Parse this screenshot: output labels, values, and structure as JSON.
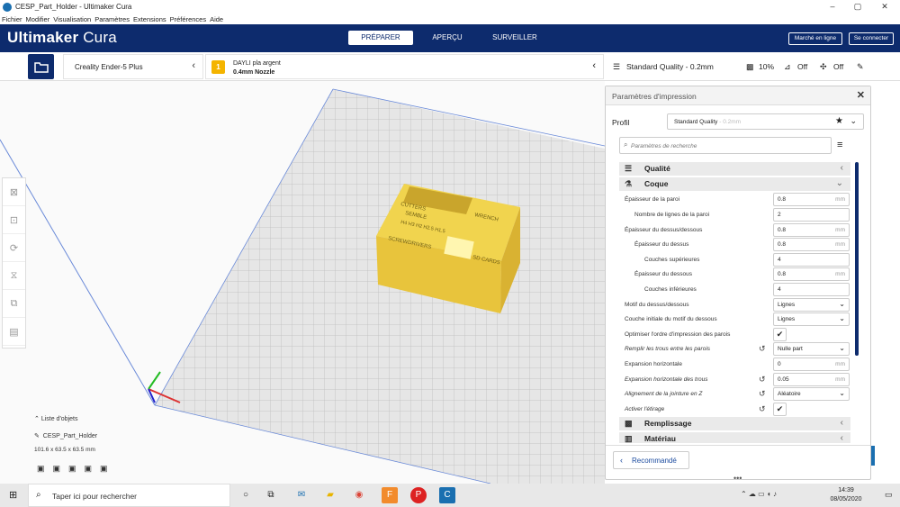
{
  "window": {
    "title": "CESP_Part_Holder - Ultimaker Cura",
    "minimize": "–",
    "maximize": "▢",
    "close": "✕"
  },
  "menu": [
    "Fichier",
    "Modifier",
    "Visualisation",
    "Paramètres",
    "Extensions",
    "Préférences",
    "Aide"
  ],
  "header": {
    "brand_bold": "Ultimaker",
    "brand_light": " Cura",
    "stages": [
      "PRÉPARER",
      "APERÇU",
      "SURVEILLER"
    ],
    "active_stage": "PRÉPARER",
    "marketplace": "Marché en ligne",
    "login": "Se connecter"
  },
  "toolbar": {
    "printer": "Creality Ender-5 Plus",
    "extruder_badge": "1",
    "material": "DAYLI pla argent",
    "nozzle": "0.4mm Nozzle",
    "quality": "Standard Quality - 0.2mm",
    "infill": "10%",
    "support": "Off",
    "adhesion": "Off"
  },
  "model": {
    "label_top1": "CUTTERS",
    "label_top2": "SEMBLE",
    "label_top3": "WRENCH",
    "label_side1": "SCREWDRIVERS",
    "label_side2": "SD CARDS",
    "label_hex": "H4 H3 H2 H2.5 H1.5",
    "color": "#f4dc5a"
  },
  "objects": {
    "header": "Liste d'objets",
    "name": "CESP_Part_Holder",
    "dims": "101.6 x 63.5 x 63.5 mm"
  },
  "panel": {
    "title": "Paramètres d'impression",
    "profile_label": "Profil",
    "profile_value": "Standard Quality",
    "profile_sub": " - 0.2mm",
    "search_placeholder": "Paramètres de recherche",
    "categories": {
      "quality": "Qualité",
      "shell": "Coque",
      "infill": "Remplissage",
      "material": "Matériau"
    },
    "settings": [
      {
        "label": "Épaisseur de la paroi",
        "value": "0.8",
        "unit": "mm"
      },
      {
        "label": "Nombre de lignes de la paroi",
        "value": "2",
        "unit": ""
      },
      {
        "label": "Épaisseur du dessus/dessous",
        "value": "0.8",
        "unit": "mm"
      },
      {
        "label": "Épaisseur du dessus",
        "value": "0.8",
        "unit": "mm"
      },
      {
        "label": "Couches supérieures",
        "value": "4",
        "unit": ""
      },
      {
        "label": "Épaisseur du dessous",
        "value": "0.8",
        "unit": "mm"
      },
      {
        "label": "Couches inférieures",
        "value": "4",
        "unit": ""
      },
      {
        "label": "Motif du dessus/dessous",
        "value": "Lignes",
        "unit": ""
      },
      {
        "label": "Couche initiale du motif du dessous",
        "value": "Lignes",
        "unit": ""
      },
      {
        "label": "Optimiser l'ordre d'impression des parois",
        "value": "✔",
        "unit": ""
      },
      {
        "label": "Remplir les trous entre les parois",
        "value": "Nulle part",
        "unit": ""
      },
      {
        "label": "Expansion horizontale",
        "value": "0",
        "unit": "mm"
      },
      {
        "label": "Expansion horizontale des trous",
        "value": "0.05",
        "unit": "mm"
      },
      {
        "label": "Alignement de la jointure en Z",
        "value": "Aléatoire",
        "unit": ""
      },
      {
        "label": "Activer l'étirage",
        "value": "✔",
        "unit": ""
      }
    ],
    "recommended": "Recommandé"
  },
  "taskbar": {
    "search": "Taper ici pour rechercher",
    "time": "14:39",
    "date": "08/05/2020"
  }
}
